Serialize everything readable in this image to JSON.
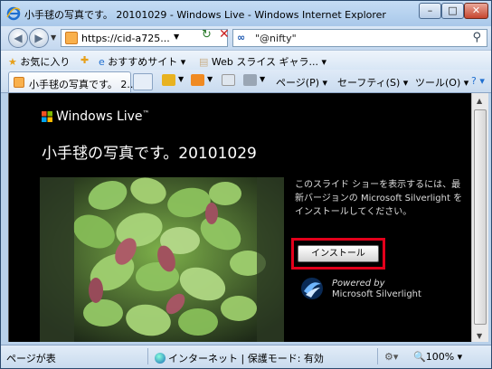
{
  "window": {
    "title": "小手毬の写真です。 20101029 - Windows Live - Windows Internet Explorer",
    "min_label": "–",
    "max_label": "□",
    "close_label": "✕"
  },
  "address": {
    "url": "https://cid-a725...",
    "search_value": "\"@nifty\"",
    "search_brand": "∞"
  },
  "favorites": {
    "favorites_label": "お気に入り",
    "suggested_label": "おすすめサイト ▾",
    "webslice_label": "Web スライス ギャラ... ▾"
  },
  "tab": {
    "label": "小手毬の写真です。 2..."
  },
  "commands": {
    "page_label": "ページ(P) ▾",
    "safety_label": "セーフティ(S) ▾",
    "tools_label": "ツール(O) ▾",
    "help_label": "? ▾"
  },
  "content": {
    "brand": "Windows Live",
    "brand_tm": "™",
    "page_title": "小手毬の写真です。20101029",
    "message": "このスライド ショーを表示するには、最新バージョンの Microsoft Silverlight をインストールしてください。",
    "install_label": "インストール",
    "powered_by": "Powered by",
    "silverlight_label": "Microsoft Silverlight"
  },
  "status": {
    "left_text": "ページが表",
    "zone_text": "インターネット | 保護モード: 有効",
    "zoom_text": "100%"
  },
  "colors": {
    "install_highlight": "#e3001b",
    "content_bg": "#000000"
  }
}
